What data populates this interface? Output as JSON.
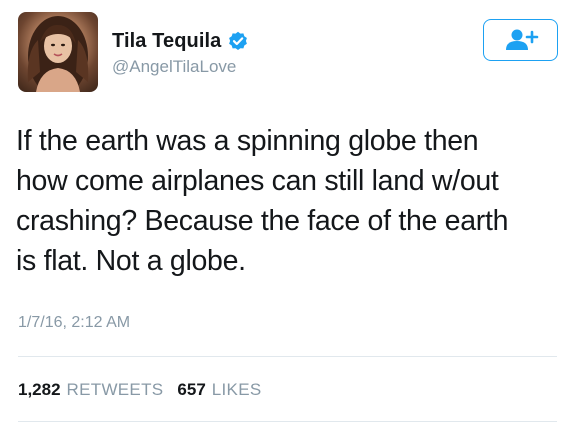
{
  "user": {
    "name": "Tila Tequila",
    "handle": "@AngelTilaLove",
    "verified": true
  },
  "tweet": {
    "lines": [
      "If the earth was a spinning globe then",
      "how come airplanes can still land w/out",
      "crashing? Because the face of the earth",
      "is flat. Not a globe."
    ],
    "timestamp": "1/7/16, 2:12 AM"
  },
  "stats": {
    "retweets_count": "1,282",
    "retweets_label": "RETWEETS",
    "likes_count": "657",
    "likes_label": "LIKES"
  },
  "icons": {
    "follow": "add-user-icon",
    "verified": "verified-badge-icon"
  },
  "colors": {
    "accent": "#1da1f2",
    "muted": "#8899a6",
    "text": "#14171a",
    "divider": "#e1e8ed"
  }
}
